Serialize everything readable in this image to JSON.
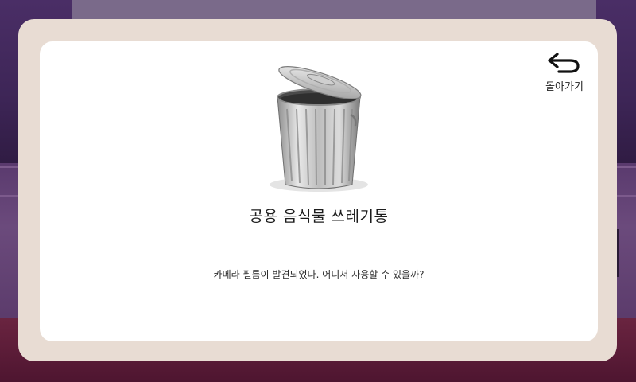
{
  "dialog": {
    "back_label": "돌아가기",
    "item_name": "공용 음식물 쓰레기통",
    "description": "카메라 필름이 발견되었다. 어디서 사용할 수 있을까?"
  },
  "icons": {
    "back": "undo-arrow-icon",
    "item": "trash-can-icon"
  },
  "colors": {
    "modal_frame": "#e8dcd3",
    "card": "#ffffff",
    "text": "#1d1d1d"
  }
}
